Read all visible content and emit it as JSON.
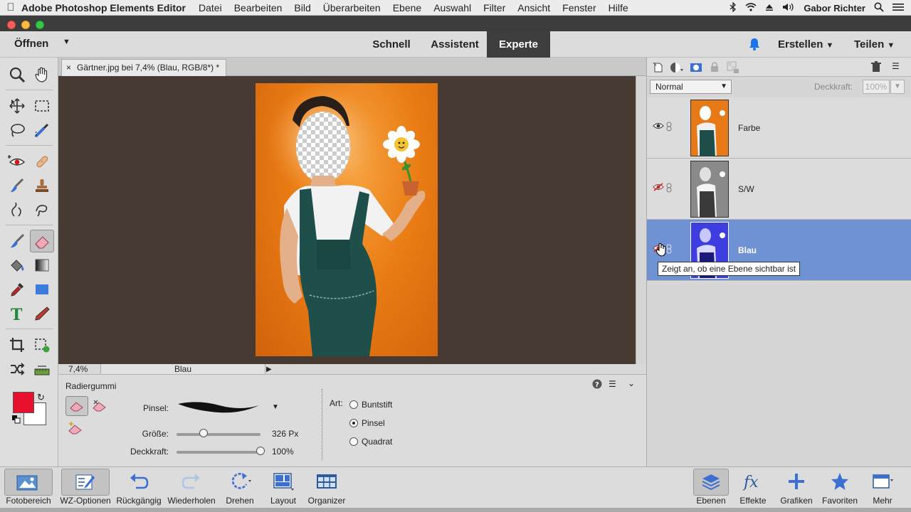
{
  "menubar": {
    "app_name": "Adobe Photoshop Elements Editor",
    "items": [
      "Datei",
      "Bearbeiten",
      "Bild",
      "Überarbeiten",
      "Ebene",
      "Auswahl",
      "Filter",
      "Ansicht",
      "Fenster",
      "Hilfe"
    ],
    "user": "Gabor Richter"
  },
  "header": {
    "open_label": "Öffnen",
    "modes": {
      "schnell": "Schnell",
      "assistent": "Assistent",
      "experte": "Experte"
    },
    "active_mode": "Experte",
    "create_label": "Erstellen",
    "share_label": "Teilen"
  },
  "document": {
    "tab_title": "Gärtner.jpg bei 7,4% (Blau, RGB/8*) *",
    "close_glyph": "×"
  },
  "status": {
    "zoom": "7,4%",
    "layer": "Blau"
  },
  "tool_options": {
    "title": "Radiergummi",
    "brush_label": "Pinsel:",
    "size_label": "Größe:",
    "size_value": "326 Px",
    "size_fraction": 0.32,
    "opacity_label": "Deckkraft:",
    "opacity_value": "100%",
    "opacity_fraction": 1.0,
    "type_label": "Art:",
    "types": [
      "Buntstift",
      "Pinsel",
      "Quadrat"
    ],
    "selected_type": "Pinsel"
  },
  "layers_panel": {
    "blend_mode": "Normal",
    "opacity_label": "Deckkraft:",
    "opacity_value": "100%",
    "layers": [
      {
        "name": "Farbe",
        "visible": true,
        "selected": false
      },
      {
        "name": "S/W",
        "visible": false,
        "selected": false
      },
      {
        "name": "Blau",
        "visible": false,
        "selected": true
      }
    ],
    "tooltip": "Zeigt an, ob eine Ebene sichtbar ist"
  },
  "bottom_bar": {
    "left": [
      "Fotobereich",
      "WZ-Optionen",
      "Rückgängig",
      "Wiederholen",
      "Drehen",
      "Layout",
      "Organizer"
    ],
    "right": [
      "Ebenen",
      "Effekte",
      "Grafiken",
      "Favoriten",
      "Mehr"
    ]
  },
  "colors": {
    "foreground": "#e8112d",
    "background": "#ffffff",
    "accent_blue": "#6e92d2",
    "canvas_bg": "#463a32",
    "photo_orange": "#ea7c14"
  }
}
